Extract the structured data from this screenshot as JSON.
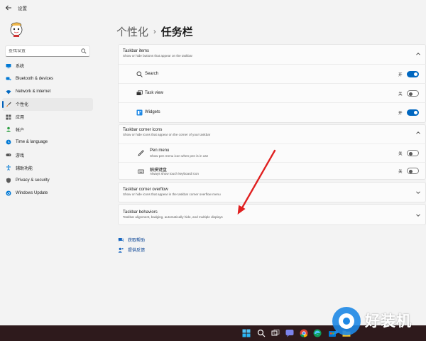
{
  "window": {
    "title": "设置"
  },
  "sidebar": {
    "search": {
      "placeholder": "查找设置"
    },
    "items": [
      {
        "label": "系统",
        "icon": "monitor-icon",
        "color": "#0078d4"
      },
      {
        "label": "Bluetooth & devices",
        "icon": "bluetooth-icon",
        "color": "#0078d4"
      },
      {
        "label": "Network & internet",
        "icon": "wifi-icon",
        "color": "#0067c0"
      },
      {
        "label": "个性化",
        "icon": "brush-icon",
        "color": "#555555",
        "selected": true
      },
      {
        "label": "应用",
        "icon": "apps-icon",
        "color": "#555555"
      },
      {
        "label": "帐户",
        "icon": "person-icon",
        "color": "#2ea043"
      },
      {
        "label": "Time & language",
        "icon": "globe-clock-icon",
        "color": "#0078d4"
      },
      {
        "label": "游戏",
        "icon": "gamepad-icon",
        "color": "#555555"
      },
      {
        "label": "辅助功能",
        "icon": "accessibility-icon",
        "color": "#0078d4"
      },
      {
        "label": "Privacy & security",
        "icon": "shield-icon",
        "color": "#5a5a5a"
      },
      {
        "label": "Windows Update",
        "icon": "update-icon",
        "color": "#0078d4"
      }
    ]
  },
  "breadcrumb": {
    "parent": "个性化",
    "separator": "›",
    "current": "任务栏"
  },
  "taskbar_items": {
    "title": "Taskbar items",
    "subtitle": "Show or hide buttons that appear on the taskbar",
    "rows": [
      {
        "label": "Search",
        "icon": "search-icon",
        "state_label": "开",
        "on": true
      },
      {
        "label": "Task view",
        "icon": "task-view-icon",
        "state_label": "关",
        "on": false
      },
      {
        "label": "Widgets",
        "icon": "widgets-icon",
        "state_label": "开",
        "on": true
      }
    ]
  },
  "corner_icons": {
    "title": "Taskbar corner icons",
    "subtitle": "Show or hide icons that appear on the corner of your taskbar",
    "rows": [
      {
        "label": "Pen menu",
        "sub": "Show pen menu icon when pen is in use",
        "icon": "pen-icon",
        "state_label": "关",
        "on": false
      },
      {
        "label": "触摸键盘",
        "sub": "Always show touch keyboard icon",
        "icon": "keyboard-icon",
        "state_label": "关",
        "on": false
      }
    ]
  },
  "corner_overflow": {
    "title": "Taskbar corner overflow",
    "subtitle": "Show or hide icons that appear in the taskbar corner overflow menu"
  },
  "behaviors": {
    "title": "Taskbar behaviors",
    "subtitle": "Taskbar alignment, badging, automatically hide, and multiple displays"
  },
  "links": {
    "help": "获取帮助",
    "feedback": "提供反馈"
  },
  "taskbar": {
    "icons": [
      "start-icon",
      "search-icon",
      "task-view-icon",
      "chat-icon",
      "file-explorer-icon",
      "chrome-icon",
      "edge-icon",
      "store-icon",
      "photos-icon"
    ]
  },
  "watermark": {
    "text": "好装机"
  },
  "colors": {
    "accent": "#0067c0",
    "annotation_arrow": "#e02020",
    "taskbar_bg": "#2e1a1c"
  }
}
